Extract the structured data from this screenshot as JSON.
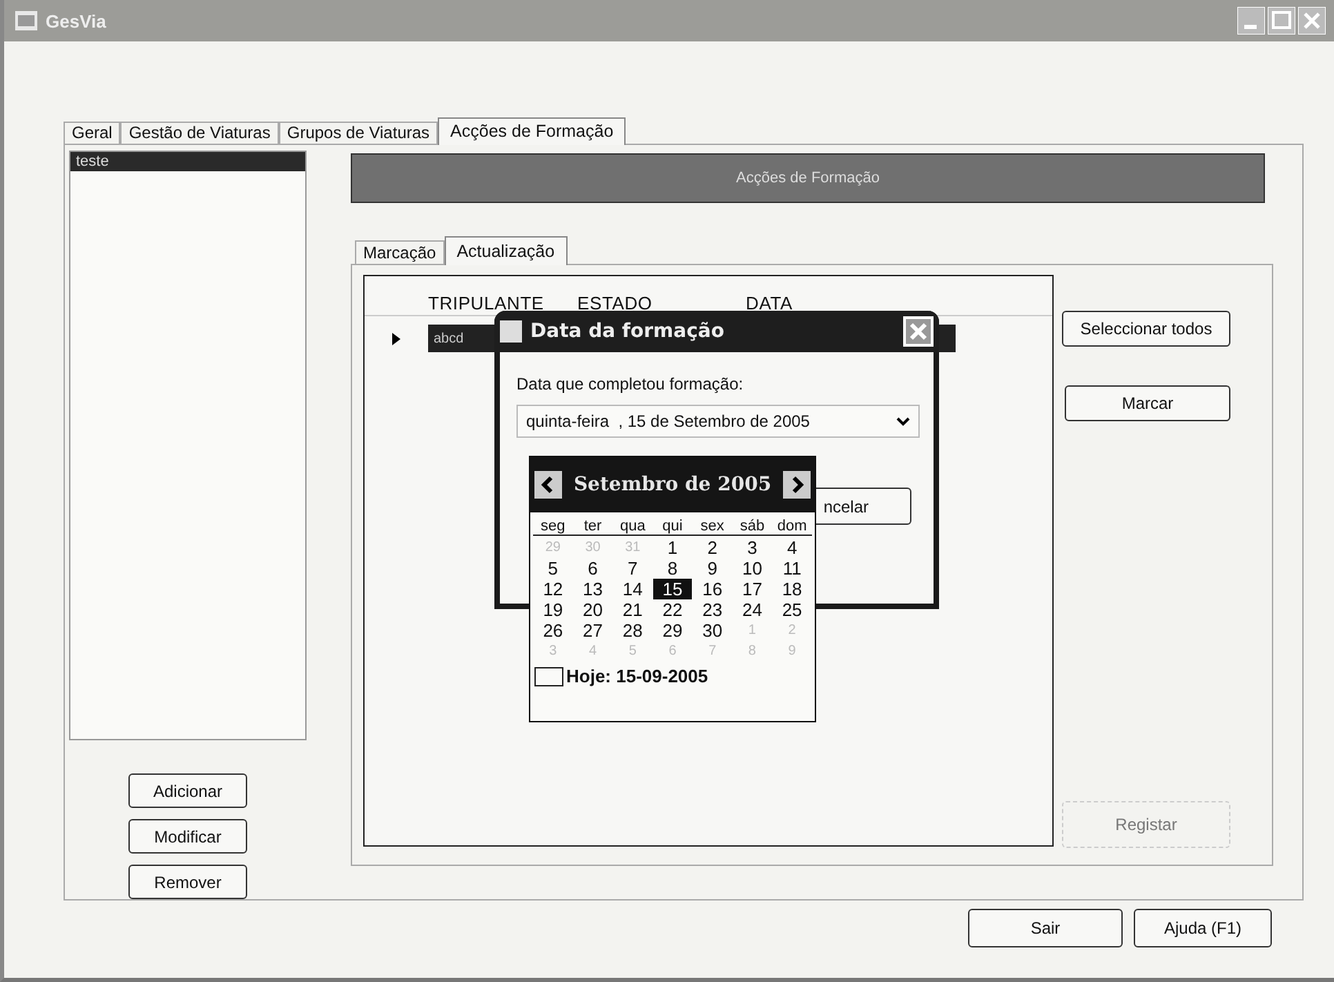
{
  "window": {
    "title": "GesVia"
  },
  "tabs": [
    {
      "label": "Geral",
      "selected": false
    },
    {
      "label": "Gestão de Viaturas",
      "selected": false
    },
    {
      "label": "Grupos de Viaturas",
      "selected": false
    },
    {
      "label": "Acções de Formação",
      "selected": true
    }
  ],
  "list": {
    "items": [
      {
        "label": "teste",
        "selected": true
      }
    ]
  },
  "list_buttons": [
    "Adicionar",
    "Modificar",
    "Remover"
  ],
  "header": "Acções de Formação",
  "subtabs": [
    {
      "label": "Marcação",
      "selected": false
    },
    {
      "label": "Actualização",
      "selected": true
    }
  ],
  "table": {
    "columns": [
      "TRIPULANTE",
      "ESTADO",
      "DATA"
    ],
    "rows": [
      {
        "cells": [
          "abcd"
        ],
        "selected": true
      }
    ]
  },
  "side_buttons": [
    {
      "label": "Seleccionar todos",
      "disabled": false
    },
    {
      "label": "Marcar",
      "disabled": false
    },
    {
      "label": "Registar",
      "disabled": true
    }
  ],
  "dialog": {
    "title": "Data da formação",
    "label": "Data que completou formação:",
    "value": "quinta-feira  , 15 de Setembro de 2005",
    "cancel_button": "ncelar"
  },
  "calendar": {
    "title": "Setembro de 2005",
    "weekdays": [
      "seg",
      "ter",
      "qua",
      "qui",
      "sex",
      "sáb",
      "dom"
    ],
    "days": [
      {
        "label": "29",
        "kind": "other",
        "selected": false
      },
      {
        "label": "30",
        "kind": "other",
        "selected": false
      },
      {
        "label": "31",
        "kind": "other",
        "selected": false
      },
      {
        "label": "1",
        "kind": "current",
        "selected": false
      },
      {
        "label": "2",
        "kind": "current",
        "selected": false
      },
      {
        "label": "3",
        "kind": "current",
        "selected": false
      },
      {
        "label": "4",
        "kind": "current",
        "selected": false
      },
      {
        "label": "5",
        "kind": "current",
        "selected": false
      },
      {
        "label": "6",
        "kind": "current",
        "selected": false
      },
      {
        "label": "7",
        "kind": "current",
        "selected": false
      },
      {
        "label": "8",
        "kind": "current",
        "selected": false
      },
      {
        "label": "9",
        "kind": "current",
        "selected": false
      },
      {
        "label": "10",
        "kind": "current",
        "selected": false
      },
      {
        "label": "11",
        "kind": "current",
        "selected": false
      },
      {
        "label": "12",
        "kind": "current",
        "selected": false
      },
      {
        "label": "13",
        "kind": "current",
        "selected": false
      },
      {
        "label": "14",
        "kind": "current",
        "selected": false
      },
      {
        "label": "15",
        "kind": "current",
        "selected": true
      },
      {
        "label": "16",
        "kind": "current",
        "selected": false
      },
      {
        "label": "17",
        "kind": "current",
        "selected": false
      },
      {
        "label": "18",
        "kind": "current",
        "selected": false
      },
      {
        "label": "19",
        "kind": "current",
        "selected": false
      },
      {
        "label": "20",
        "kind": "current",
        "selected": false
      },
      {
        "label": "21",
        "kind": "current",
        "selected": false
      },
      {
        "label": "22",
        "kind": "current",
        "selected": false
      },
      {
        "label": "23",
        "kind": "current",
        "selected": false
      },
      {
        "label": "24",
        "kind": "current",
        "selected": false
      },
      {
        "label": "25",
        "kind": "current",
        "selected": false
      },
      {
        "label": "26",
        "kind": "current",
        "selected": false
      },
      {
        "label": "27",
        "kind": "current",
        "selected": false
      },
      {
        "label": "28",
        "kind": "current",
        "selected": false
      },
      {
        "label": "29",
        "kind": "current",
        "selected": false
      },
      {
        "label": "30",
        "kind": "current",
        "selected": false
      },
      {
        "label": "1",
        "kind": "other",
        "selected": false
      },
      {
        "label": "2",
        "kind": "other",
        "selected": false
      },
      {
        "label": "3",
        "kind": "other",
        "selected": false
      },
      {
        "label": "4",
        "kind": "other",
        "selected": false
      },
      {
        "label": "5",
        "kind": "other",
        "selected": false
      },
      {
        "label": "6",
        "kind": "other",
        "selected": false
      },
      {
        "label": "7",
        "kind": "other",
        "selected": false
      },
      {
        "label": "8",
        "kind": "other",
        "selected": false
      },
      {
        "label": "9",
        "kind": "other",
        "selected": false
      }
    ],
    "today": "Hoje: 15-09-2005"
  },
  "bottom_buttons": [
    "Sair",
    "Ajuda (F1)"
  ]
}
